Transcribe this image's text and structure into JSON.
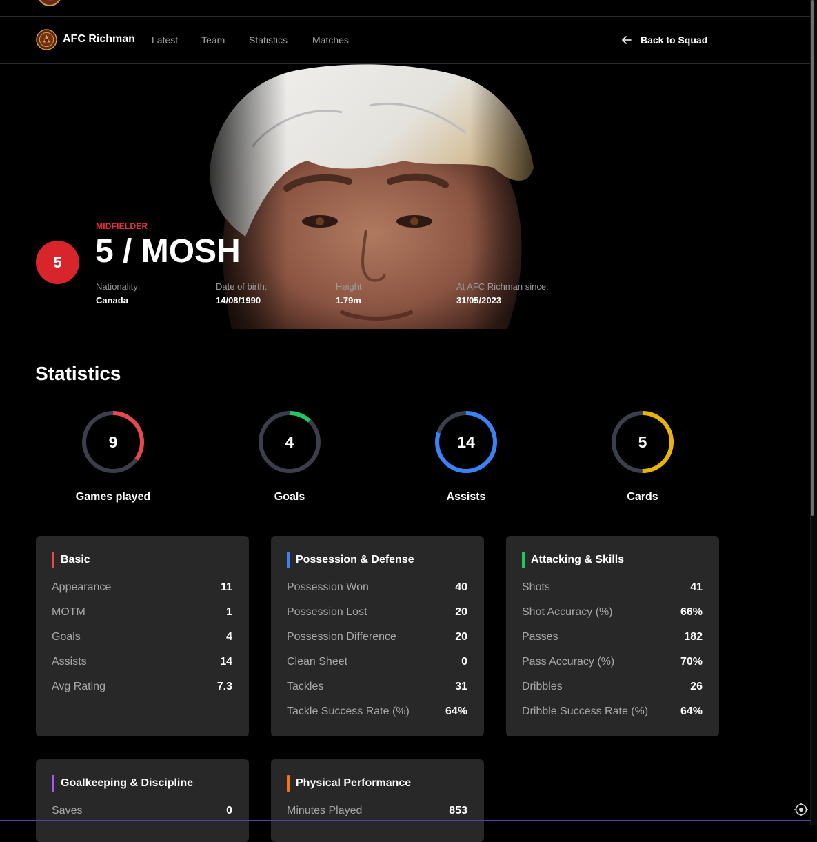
{
  "nav": {
    "brand": "AFC Richman",
    "links": [
      "Latest",
      "Team",
      "Statistics",
      "Matches"
    ],
    "back_label": "Back to Squad"
  },
  "player": {
    "number": "5",
    "position": "MIDFIELDER",
    "name": "5 / MOSH",
    "info": [
      {
        "label": "Nationality:",
        "value": "Canada"
      },
      {
        "label": "Date of birth:",
        "value": "14/08/1990"
      },
      {
        "label": "Height:",
        "value": "1.79m"
      },
      {
        "label": "At AFC Richman since:",
        "value": "31/05/2023"
      }
    ]
  },
  "statistics": {
    "title": "Statistics",
    "rings": [
      {
        "value": "9",
        "label": "Games played",
        "color": "#e5484d",
        "fraction": 0.35
      },
      {
        "value": "4",
        "label": "Goals",
        "color": "#22c55e",
        "fraction": 0.12
      },
      {
        "value": "14",
        "label": "Assists",
        "color": "#3b82f6",
        "fraction": 0.8
      },
      {
        "value": "5",
        "label": "Cards",
        "color": "#eab308",
        "fraction": 0.5
      }
    ]
  },
  "cards": [
    {
      "title": "Basic",
      "accent": "#e5484d",
      "rows": [
        {
          "k": "Appearance",
          "v": "11"
        },
        {
          "k": "MOTM",
          "v": "1"
        },
        {
          "k": "Goals",
          "v": "4"
        },
        {
          "k": "Assists",
          "v": "14"
        },
        {
          "k": "Avg Rating",
          "v": "7.3"
        }
      ]
    },
    {
      "title": "Possession & Defense",
      "accent": "#3b82f6",
      "rows": [
        {
          "k": "Possession Won",
          "v": "40"
        },
        {
          "k": "Possession Lost",
          "v": "20"
        },
        {
          "k": "Possession Difference",
          "v": "20"
        },
        {
          "k": "Clean Sheet",
          "v": "0"
        },
        {
          "k": "Tackles",
          "v": "31"
        },
        {
          "k": "Tackle Success Rate (%)",
          "v": "64%"
        }
      ]
    },
    {
      "title": "Attacking & Skills",
      "accent": "#22c55e",
      "rows": [
        {
          "k": "Shots",
          "v": "41"
        },
        {
          "k": "Shot Accuracy (%)",
          "v": "66%"
        },
        {
          "k": "Passes",
          "v": "182"
        },
        {
          "k": "Pass Accuracy (%)",
          "v": "70%"
        },
        {
          "k": "Dribbles",
          "v": "26"
        },
        {
          "k": "Dribble Success Rate (%)",
          "v": "64%"
        }
      ]
    },
    {
      "title": "Goalkeeping & Discipline",
      "accent": "#a855f7",
      "rows": [
        {
          "k": "Saves",
          "v": "0"
        }
      ]
    },
    {
      "title": "Physical Performance",
      "accent": "#f97316",
      "rows": [
        {
          "k": "Minutes Played",
          "v": "853"
        }
      ]
    }
  ]
}
